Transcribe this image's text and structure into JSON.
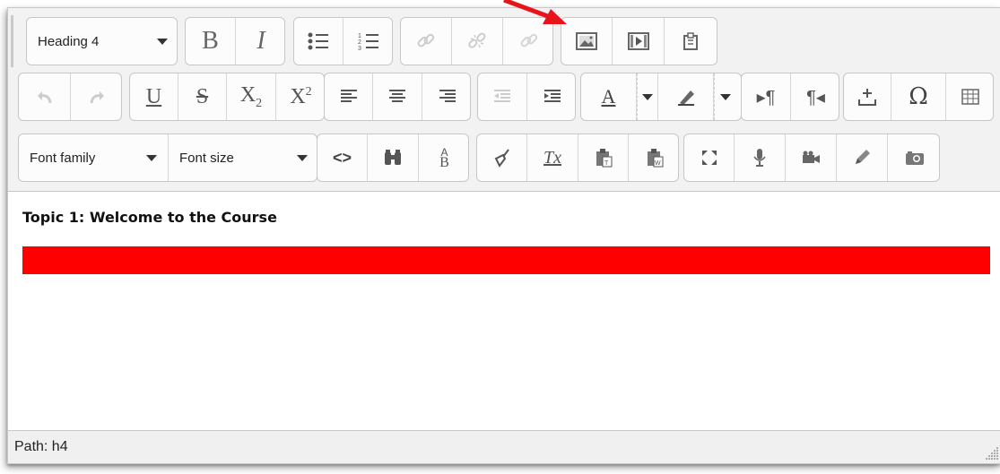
{
  "toolbar": {
    "row1": {
      "block_format": "Heading 4",
      "bold": "B",
      "italic": "I",
      "icons": [
        "bullet-list-icon",
        "numbered-list-icon",
        "link-icon",
        "unlink-icon",
        "anchor-link-icon",
        "image-icon",
        "media-icon",
        "manage-files-icon"
      ]
    },
    "row2": {
      "underline": "U",
      "strikethrough": "S",
      "subscript": "X",
      "subscript_mark": "2",
      "superscript": "X",
      "superscript_mark": "2",
      "special_char": "Ω",
      "text_color_letter": "A",
      "ltr_mark": "¶",
      "rtl_mark": "¶"
    },
    "row3": {
      "font_family": "Font family",
      "font_size": "Font size",
      "code_glyph": "<>",
      "replace_top": "A",
      "replace_bottom": "B",
      "clear_format": "Tx"
    }
  },
  "content": {
    "heading": "Topic 1: Welcome to the Course",
    "highlight_color": "#ff0000"
  },
  "statusbar": {
    "path": "Path: h4"
  },
  "annotation": {
    "arrow_color": "#e8141b"
  }
}
